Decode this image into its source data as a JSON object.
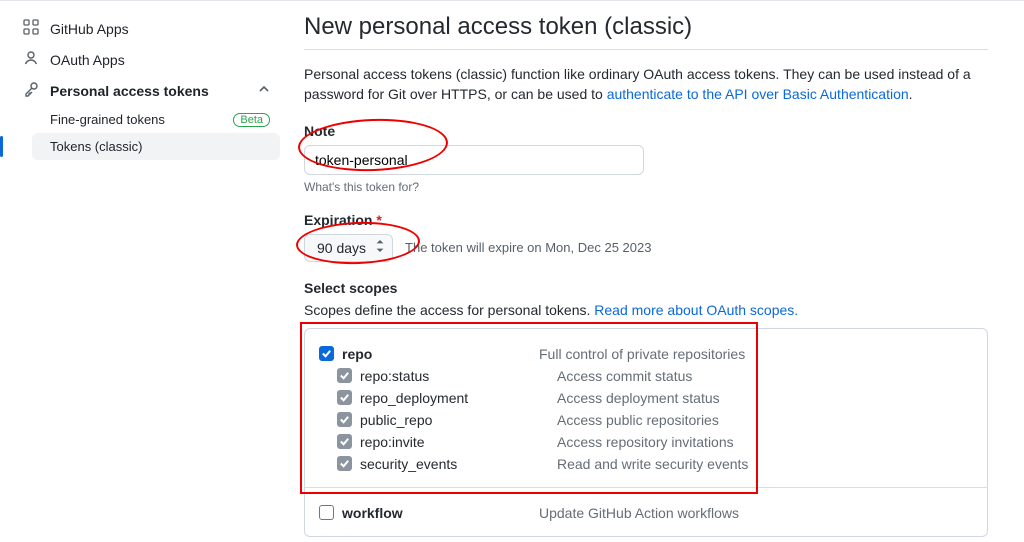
{
  "sidebar": {
    "items": [
      {
        "icon": "apps",
        "label": "GitHub Apps"
      },
      {
        "icon": "person",
        "label": "OAuth Apps"
      },
      {
        "icon": "key",
        "label": "Personal access tokens"
      }
    ],
    "sub_items": {
      "fine_grained": "Fine-grained tokens",
      "beta": "Beta",
      "classic": "Tokens (classic)"
    }
  },
  "page": {
    "title": "New personal access token (classic)",
    "intro_prefix": "Personal access tokens (classic) function like ordinary OAuth access tokens. They can be used instead of a password for Git over HTTPS, or can be used to ",
    "intro_link": "authenticate to the API over Basic Authentication",
    "note": {
      "label": "Note",
      "value": "token-personal",
      "help": "What's this token for?"
    },
    "expiration": {
      "label": "Expiration",
      "value": "90 days",
      "hint": "The token will expire on Mon, Dec 25 2023"
    },
    "scopes": {
      "label": "Select scopes",
      "desc_prefix": "Scopes define the access for personal tokens. ",
      "desc_link": "Read more about OAuth scopes."
    },
    "scope_groups": [
      {
        "name": "repo",
        "desc": "Full control of private repositories",
        "checked": true,
        "children": [
          {
            "name": "repo:status",
            "desc": "Access commit status"
          },
          {
            "name": "repo_deployment",
            "desc": "Access deployment status"
          },
          {
            "name": "public_repo",
            "desc": "Access public repositories"
          },
          {
            "name": "repo:invite",
            "desc": "Access repository invitations"
          },
          {
            "name": "security_events",
            "desc": "Read and write security events"
          }
        ]
      },
      {
        "name": "workflow",
        "desc": "Update GitHub Action workflows",
        "checked": false,
        "children": []
      }
    ]
  }
}
